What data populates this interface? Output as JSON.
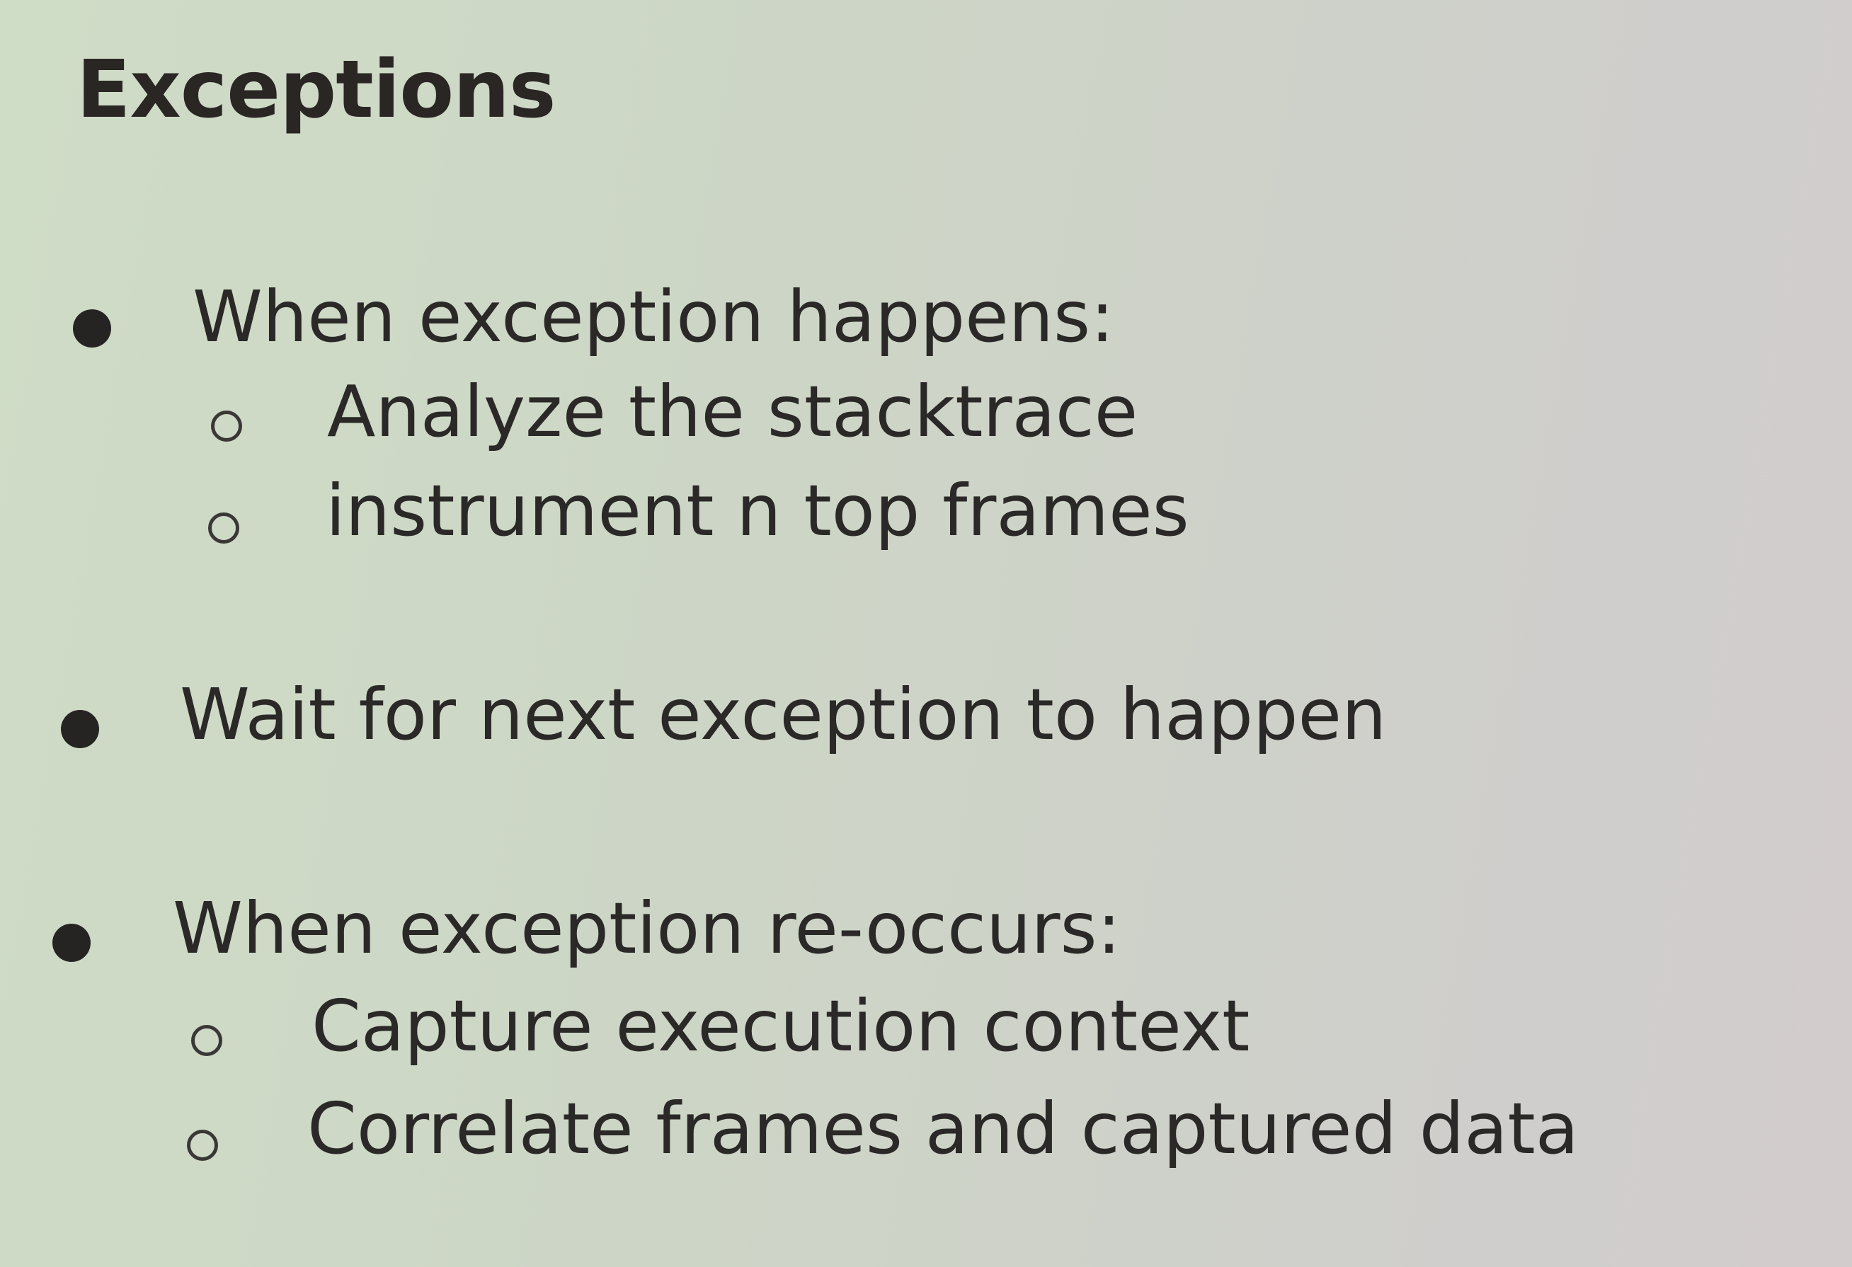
{
  "slide": {
    "title": "Exceptions",
    "items": [
      {
        "text": "When exception happens:",
        "subitems": [
          "Analyze the stacktrace",
          "instrument n top frames"
        ]
      },
      {
        "text": "Wait for next exception to happen",
        "subitems": []
      },
      {
        "text": "When exception re-occurs:",
        "subitems": [
          "Capture execution context",
          "Correlate frames and captured data"
        ]
      }
    ]
  }
}
